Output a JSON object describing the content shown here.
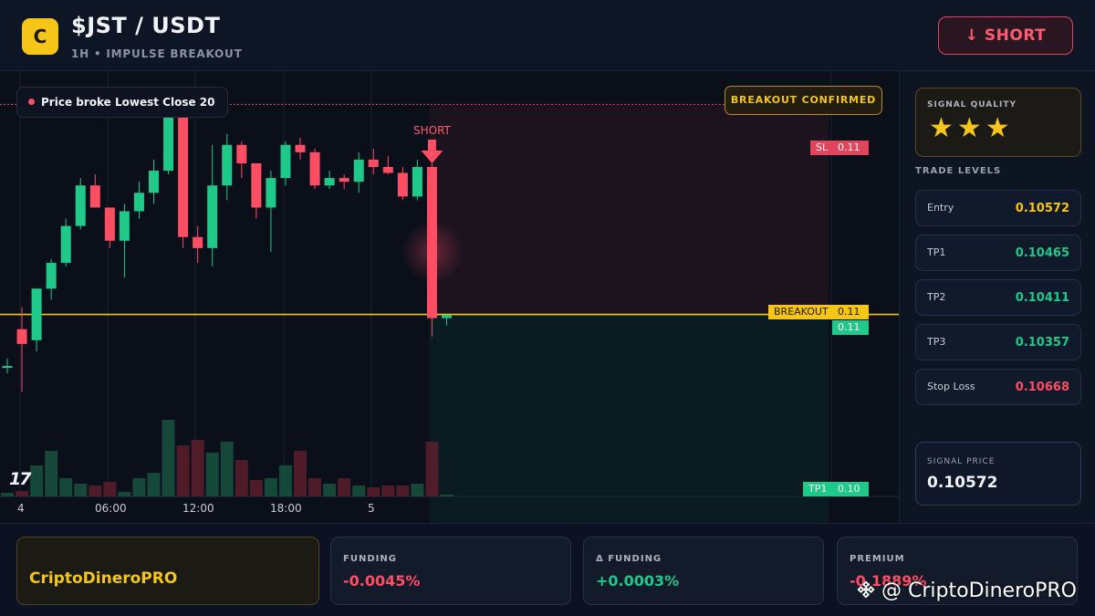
{
  "header": {
    "logo_letter": "C",
    "pair": "$JST / USDT",
    "subtitle": "1H • IMPULSE BREAKOUT",
    "action_label": "↓ SHORT"
  },
  "chart": {
    "legend": "Price broke Lowest Close 20",
    "status_badge": "BREAKOUT CONFIRMED",
    "signal_marker": "SHORT",
    "price_tags": {
      "sl_label": "SL",
      "sl_value": "0.11",
      "breakout_label": "BREAKOUT",
      "breakout_value": "0.11",
      "current_value": "0.11",
      "tp1_label": "TP1",
      "tp1_value": "0.10"
    },
    "time_axis": [
      "4",
      "06:00",
      "12:00",
      "18:00",
      "5"
    ],
    "tv_logo": "17",
    "colors": {
      "up": "#1fc98a",
      "down": "#ff4d64",
      "breakout": "#f5c518"
    }
  },
  "chart_data": {
    "type": "candlestick",
    "x_ticks": [
      "4",
      "06:00",
      "12:00",
      "18:00",
      "5"
    ],
    "candles": [
      {
        "o": 0.106,
        "h": 0.1061,
        "l": 0.1059,
        "c": 0.106
      },
      {
        "o": 0.1065,
        "h": 0.1068,
        "l": 0.10565,
        "c": 0.1063
      },
      {
        "o": 0.10635,
        "h": 0.1069,
        "l": 0.1062,
        "c": 0.10705
      },
      {
        "o": 0.10705,
        "h": 0.10745,
        "l": 0.1069,
        "c": 0.1074
      },
      {
        "o": 0.1074,
        "h": 0.108,
        "l": 0.10735,
        "c": 0.1079
      },
      {
        "o": 0.1079,
        "h": 0.10855,
        "l": 0.10785,
        "c": 0.10845
      },
      {
        "o": 0.10845,
        "h": 0.1086,
        "l": 0.1082,
        "c": 0.10815
      },
      {
        "o": 0.10815,
        "h": 0.10805,
        "l": 0.1076,
        "c": 0.1077
      },
      {
        "o": 0.1077,
        "h": 0.1082,
        "l": 0.1072,
        "c": 0.1081
      },
      {
        "o": 0.1081,
        "h": 0.1085,
        "l": 0.108,
        "c": 0.10835
      },
      {
        "o": 0.10835,
        "h": 0.1088,
        "l": 0.1082,
        "c": 0.10865
      },
      {
        "o": 0.10865,
        "h": 0.1097,
        "l": 0.1086,
        "c": 0.1095
      },
      {
        "o": 0.1095,
        "h": 0.10915,
        "l": 0.1076,
        "c": 0.10775
      },
      {
        "o": 0.10775,
        "h": 0.1079,
        "l": 0.1074,
        "c": 0.1076
      },
      {
        "o": 0.1076,
        "h": 0.109,
        "l": 0.10735,
        "c": 0.10845
      },
      {
        "o": 0.10845,
        "h": 0.10915,
        "l": 0.10825,
        "c": 0.109
      },
      {
        "o": 0.109,
        "h": 0.10905,
        "l": 0.10855,
        "c": 0.10875
      },
      {
        "o": 0.10875,
        "h": 0.1087,
        "l": 0.108,
        "c": 0.10815
      },
      {
        "o": 0.10815,
        "h": 0.10865,
        "l": 0.10755,
        "c": 0.10855
      },
      {
        "o": 0.10855,
        "h": 0.10905,
        "l": 0.10845,
        "c": 0.109
      },
      {
        "o": 0.109,
        "h": 0.1091,
        "l": 0.1088,
        "c": 0.1089
      },
      {
        "o": 0.1089,
        "h": 0.10895,
        "l": 0.1084,
        "c": 0.10845
      },
      {
        "o": 0.10845,
        "h": 0.10865,
        "l": 0.1084,
        "c": 0.10855
      },
      {
        "o": 0.10855,
        "h": 0.1086,
        "l": 0.1084,
        "c": 0.1085
      },
      {
        "o": 0.1085,
        "h": 0.1089,
        "l": 0.10835,
        "c": 0.1088
      },
      {
        "o": 0.1088,
        "h": 0.10895,
        "l": 0.1086,
        "c": 0.1087
      },
      {
        "o": 0.1087,
        "h": 0.10885,
        "l": 0.1086,
        "c": 0.10862
      },
      {
        "o": 0.10862,
        "h": 0.1087,
        "l": 0.10825,
        "c": 0.1083
      },
      {
        "o": 0.1083,
        "h": 0.1088,
        "l": 0.10825,
        "c": 0.1087
      },
      {
        "o": 0.1087,
        "h": 0.10875,
        "l": 0.1064,
        "c": 0.10665
      },
      {
        "o": 0.10665,
        "h": 0.1067,
        "l": 0.10655,
        "c": 0.10668
      }
    ],
    "volumes": [
      4,
      6,
      34,
      50,
      20,
      14,
      12,
      16,
      5,
      20,
      26,
      84,
      56,
      62,
      48,
      60,
      40,
      18,
      20,
      34,
      50,
      20,
      14,
      20,
      12,
      10,
      12,
      12,
      14,
      60,
      2
    ],
    "levels": {
      "sl": 0.10955,
      "breakout": 0.1067,
      "tp1": 0.1039
    }
  },
  "panel": {
    "quality_label": "SIGNAL QUALITY",
    "stars": "★★★",
    "levels_title": "TRADE LEVELS",
    "levels": [
      {
        "name": "Entry",
        "value": "0.10572",
        "color": "#f5c518"
      },
      {
        "name": "TP1",
        "value": "0.10465",
        "color": "#1fc98a"
      },
      {
        "name": "TP2",
        "value": "0.10411",
        "color": "#1fc98a"
      },
      {
        "name": "TP3",
        "value": "0.10357",
        "color": "#1fc98a"
      },
      {
        "name": "Stop Loss",
        "value": "0.10668",
        "color": "#ff4d64"
      }
    ],
    "signal_price_label": "SIGNAL PRICE",
    "signal_price": "0.10572"
  },
  "footer": {
    "brand": "CriptoDineroPRO",
    "stats": [
      {
        "label": "FUNDING",
        "value": "-0.0045%",
        "color": "#ff4d64"
      },
      {
        "label": "Δ FUNDING",
        "value": "+0.0003%",
        "color": "#1fc98a"
      },
      {
        "label": "PREMIUM",
        "value": "-0.1889%",
        "color": "#ff4d64"
      }
    ],
    "watermark": "@ CriptoDineroPRO"
  }
}
